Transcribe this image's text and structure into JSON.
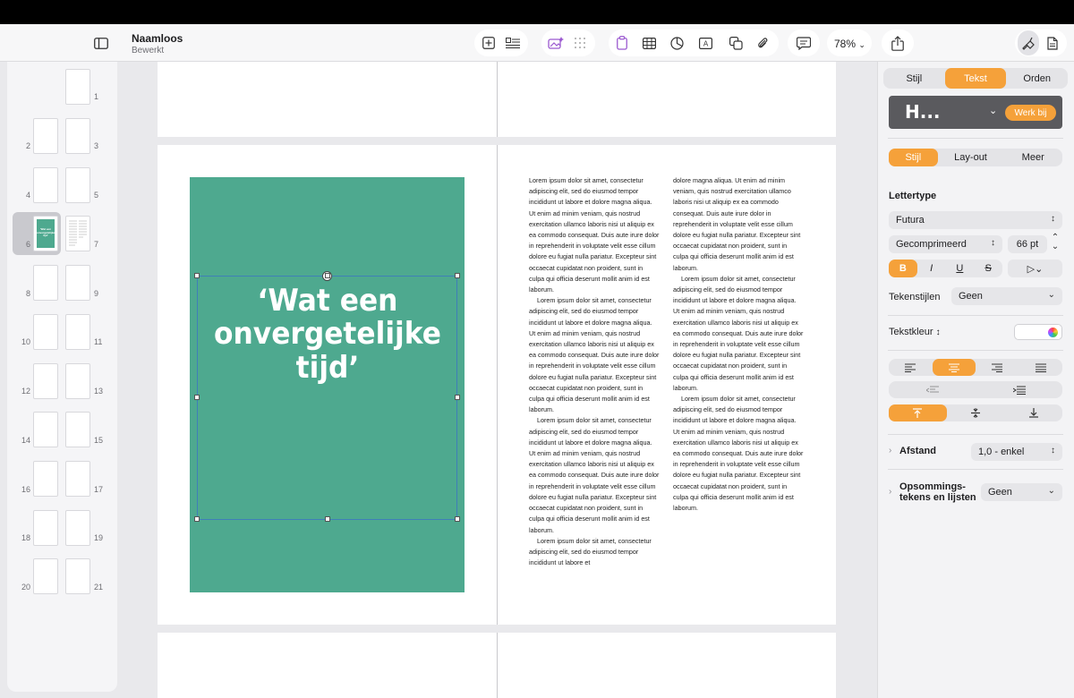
{
  "app": {
    "document_title": "Naamloos",
    "document_status": "Bewerkt",
    "zoom": "78%"
  },
  "sidebar": {
    "thumbnails": [
      {
        "num": "1"
      },
      {
        "num": "2"
      },
      {
        "num": "3"
      },
      {
        "num": "4"
      },
      {
        "num": "5"
      },
      {
        "num": "6"
      },
      {
        "num": "7"
      },
      {
        "num": "8"
      },
      {
        "num": "9"
      },
      {
        "num": "10"
      },
      {
        "num": "11"
      },
      {
        "num": "12"
      },
      {
        "num": "13"
      },
      {
        "num": "14"
      },
      {
        "num": "15"
      },
      {
        "num": "16"
      },
      {
        "num": "17"
      },
      {
        "num": "18"
      },
      {
        "num": "19"
      },
      {
        "num": "20"
      },
      {
        "num": "21"
      }
    ],
    "selected": "6",
    "thumb_quote": "'Wat een onvergetelijke tijd'"
  },
  "document": {
    "quote_line1": "‘Wat een",
    "quote_line2": "onvergetelijke",
    "quote_line3": "tijd’",
    "accent_green": "#4ea98f",
    "column1": [
      "Lorem ipsum dolor sit amet, consectetur adipiscing elit, sed do eiusmod tempor incididunt ut labore et dolore magna aliqua. Ut enim ad minim veniam, quis nostrud exercitation ullamco laboris nisi ut aliquip ex ea commodo consequat. Duis aute irure dolor in reprehenderit in voluptate velit esse cillum dolore eu fugiat nulla pariatur. Excepteur sint occaecat cupidatat non proident, sunt in culpa qui officia deserunt mollit anim id est laborum.",
      "Lorem ipsum dolor sit amet, consectetur adipiscing elit, sed do eiusmod tempor incididunt ut labore et dolore magna aliqua. Ut enim ad minim veniam, quis nostrud exercitation ullamco laboris nisi ut aliquip ex ea commodo consequat. Duis aute irure dolor in reprehenderit in voluptate velit esse cillum dolore eu fugiat nulla pariatur. Excepteur sint occaecat cupidatat non proident, sunt in culpa qui officia deserunt mollit anim id est laborum.",
      "Lorem ipsum dolor sit amet, consectetur adipiscing elit, sed do eiusmod tempor incididunt ut labore et dolore magna aliqua. Ut enim ad minim veniam, quis nostrud exercitation ullamco laboris nisi ut aliquip ex ea commodo consequat. Duis aute irure dolor in reprehenderit in voluptate velit esse cillum dolore eu fugiat nulla pariatur. Excepteur sint occaecat cupidatat non proident, sunt in culpa qui officia deserunt mollit anim id est laborum.",
      "Lorem ipsum dolor sit amet, consectetur adipiscing elit, sed do eiusmod tempor incididunt ut labore et"
    ],
    "column2": [
      "dolore magna aliqua. Ut enim ad minim veniam, quis nostrud exercitation ullamco laboris nisi ut aliquip ex ea commodo consequat. Duis aute irure dolor in reprehenderit in voluptate velit esse cillum dolore eu fugiat nulla pariatur. Excepteur sint occaecat cupidatat non proident, sunt in culpa qui officia deserunt mollit anim id est laborum.",
      "Lorem ipsum dolor sit amet, consectetur adipiscing elit, sed do eiusmod tempor incididunt ut labore et dolore magna aliqua. Ut enim ad minim veniam, quis nostrud exercitation ullamco laboris nisi ut aliquip ex ea commodo consequat. Duis aute irure dolor in reprehenderit in voluptate velit esse cillum dolore eu fugiat nulla pariatur. Excepteur sint occaecat cupidatat non proident, sunt in culpa qui officia deserunt mollit anim id est laborum.",
      "Lorem ipsum dolor sit amet, consectetur adipiscing elit, sed do eiusmod tempor incididunt ut labore et dolore magna aliqua. Ut enim ad minim veniam, quis nostrud exercitation ullamco laboris nisi ut aliquip ex ea commodo consequat. Duis aute irure dolor in reprehenderit in voluptate velit esse cillum dolore eu fugiat nulla pariatur. Excepteur sint occaecat cupidatat non proident, sunt in culpa qui officia deserunt mollit anim id est laborum."
    ]
  },
  "inspector": {
    "tabs": [
      "Stijl",
      "Tekst",
      "Orden"
    ],
    "active_tab": "Tekst",
    "paragraph_style": "H...",
    "update_button": "Werk bij",
    "subtabs": [
      "Stijl",
      "Lay-out",
      "Meer"
    ],
    "active_subtab": "Stijl",
    "font_section": "Lettertype",
    "font_family": "Futura",
    "font_typeface": "Gecomprimeerd",
    "font_size": "66 pt",
    "format_buttons": [
      "B",
      "I",
      "U",
      "S"
    ],
    "char_styles_label": "Tekenstijlen",
    "char_styles_value": "Geen",
    "text_color_label": "Tekstkleur",
    "spacing_label": "Afstand",
    "spacing_value": "1,0 - enkel",
    "bullets_label_1": "Opsommings-",
    "bullets_label_2": "tekens en lijsten",
    "bullets_value": "Geen",
    "accent_color": "#f5a13a"
  }
}
